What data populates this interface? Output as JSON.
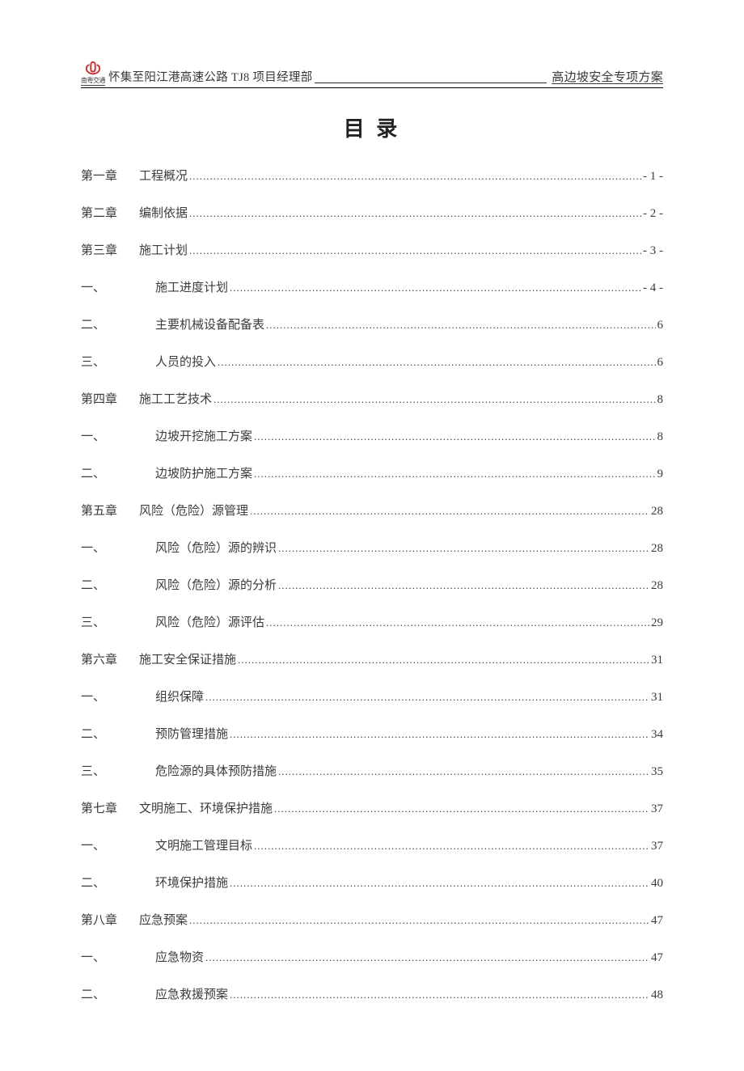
{
  "header": {
    "logo_text": "南粤交通",
    "left_text": "怀集至阳江港高速公路 TJ8 项目经理部",
    "right_text": "高边坡安全专项方案"
  },
  "toc": {
    "title": "目 录",
    "entries": [
      {
        "prefix": "第一章",
        "label": "工程概况",
        "page": "- 1 -",
        "sub": false
      },
      {
        "prefix": "第二章",
        "label": "编制依据",
        "page": "- 2 -",
        "sub": false
      },
      {
        "prefix": "第三章",
        "label": "施工计划",
        "page": "- 3 -",
        "sub": false
      },
      {
        "prefix": "一、",
        "label": "施工进度计划",
        "page": "- 4 -",
        "sub": true
      },
      {
        "prefix": "二、",
        "label": "主要机械设备配备表",
        "page": "6",
        "sub": true
      },
      {
        "prefix": "三、",
        "label": "人员的投入",
        "page": "6",
        "sub": true
      },
      {
        "prefix": "第四章",
        "label": "施工工艺技术",
        "page": "8",
        "sub": false
      },
      {
        "prefix": "一、",
        "label": "边坡开挖施工方案",
        "page": "8",
        "sub": true
      },
      {
        "prefix": "二、",
        "label": "边坡防护施工方案",
        "page": "9",
        "sub": true
      },
      {
        "prefix": "第五章",
        "label": "风险（危险）源管理",
        "page": "28",
        "sub": false
      },
      {
        "prefix": "一、",
        "label": "风险（危险）源的辨识",
        "page": "28",
        "sub": true
      },
      {
        "prefix": "二、",
        "label": "风险（危险）源的分析",
        "page": "28",
        "sub": true
      },
      {
        "prefix": "三、",
        "label": "风险（危险）源评估",
        "page": "29",
        "sub": true
      },
      {
        "prefix": "第六章",
        "label": "施工安全保证措施",
        "page": "31",
        "sub": false
      },
      {
        "prefix": "一、",
        "label": "组织保障",
        "page": "31",
        "sub": true
      },
      {
        "prefix": "二、",
        "label": "预防管理措施",
        "page": "34",
        "sub": true
      },
      {
        "prefix": "三、",
        "label": "危险源的具体预防措施",
        "page": "35",
        "sub": true
      },
      {
        "prefix": "第七章",
        "label": "文明施工、环境保护措施",
        "page": "37",
        "sub": false
      },
      {
        "prefix": "一、",
        "label": "文明施工管理目标",
        "page": "37",
        "sub": true
      },
      {
        "prefix": "二、",
        "label": "环境保护措施",
        "page": "40",
        "sub": true
      },
      {
        "prefix": "第八章",
        "label": "应急预案",
        "page": "47",
        "sub": false
      },
      {
        "prefix": "一、",
        "label": "应急物资",
        "page": "47",
        "sub": true
      },
      {
        "prefix": "二、",
        "label": "应急救援预案",
        "page": "48",
        "sub": true
      }
    ]
  }
}
